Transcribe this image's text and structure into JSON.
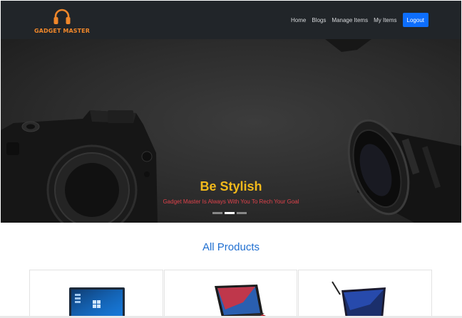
{
  "brand": {
    "name": "GADGET MASTER",
    "icon": "headphones-icon"
  },
  "nav": {
    "links": [
      "Home",
      "Blogs",
      "Manage Items",
      "My Items"
    ],
    "logout_label": "Logout"
  },
  "hero": {
    "title": "Be Stylish",
    "subtitle": "Gadget Master Is Always With You To Rech Your Goal",
    "slides": 3,
    "active_slide": 2
  },
  "products": {
    "section_title": "All Products",
    "items": [
      {
        "image": "laptop-image"
      },
      {
        "image": "laptop-image"
      },
      {
        "image": "laptop-image"
      }
    ]
  },
  "colors": {
    "navbar_bg": "#212529",
    "brand": "#f0872a",
    "logout_button": "#0d6efd",
    "hero_title": "#f2b91b",
    "hero_subtitle": "#e0424b",
    "section_title": "#1f6fd1"
  }
}
